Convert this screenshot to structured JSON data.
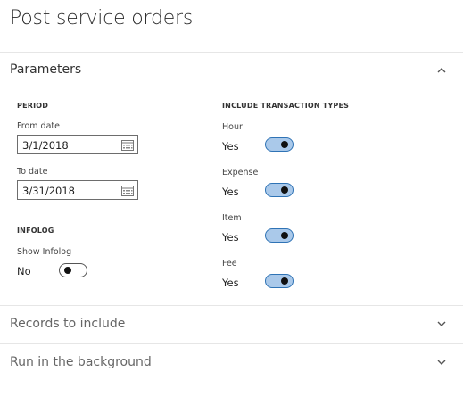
{
  "page": {
    "title": "Post service orders"
  },
  "sections": {
    "parameters": {
      "title": "Parameters",
      "expanded": true
    },
    "records": {
      "title": "Records to include",
      "expanded": false
    },
    "background": {
      "title": "Run in the background",
      "expanded": false
    }
  },
  "period": {
    "group_label": "PERIOD",
    "from_label": "From date",
    "from_value": "3/1/2018",
    "to_label": "To date",
    "to_value": "3/31/2018"
  },
  "infolog": {
    "group_label": "INFOLOG",
    "show_label": "Show Infolog",
    "show_value": "No",
    "show_on": false
  },
  "transaction_types": {
    "group_label": "INCLUDE TRANSACTION TYPES",
    "items": [
      {
        "label": "Hour",
        "value": "Yes",
        "on": true
      },
      {
        "label": "Expense",
        "value": "Yes",
        "on": true
      },
      {
        "label": "Item",
        "value": "Yes",
        "on": true
      },
      {
        "label": "Fee",
        "value": "Yes",
        "on": true
      }
    ]
  },
  "colors": {
    "toggle_on_fill": "#aac9ea",
    "toggle_on_border": "#2f73b5",
    "divider": "#e6e6e6"
  },
  "icons": {
    "calendar": "calendar-icon",
    "collapse": "chevron-up-icon",
    "expand": "chevron-down-icon"
  }
}
